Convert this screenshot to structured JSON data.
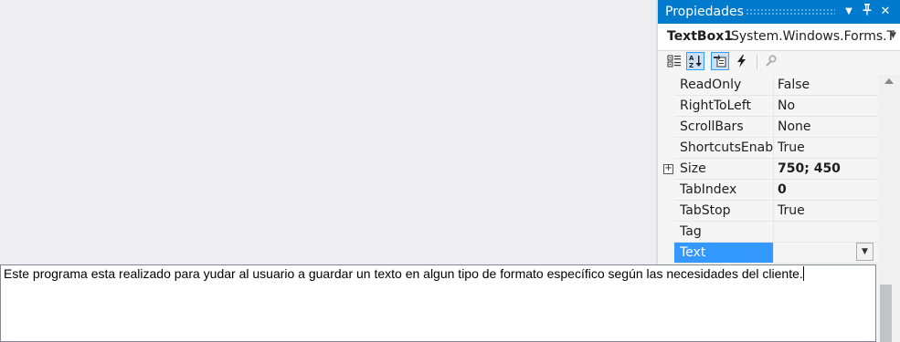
{
  "properties_panel": {
    "title": "Propiedades",
    "title_buttons": [
      "chevron-down-icon",
      "pin-icon",
      "close-icon"
    ],
    "object_selector": {
      "name": "TextBox1",
      "type": "System.Windows.Forms.T"
    },
    "toolbar_icons": [
      "categorized-icon",
      "alphabetical-icon",
      "properties-icon",
      "events-icon",
      "property-pages-icon"
    ],
    "rows": [
      {
        "name": "ReadOnly",
        "value": "False",
        "bold": false
      },
      {
        "name": "RightToLeft",
        "value": "No",
        "bold": false
      },
      {
        "name": "ScrollBars",
        "value": "None",
        "bold": false
      },
      {
        "name": "ShortcutsEnable",
        "value": "True",
        "bold": false
      },
      {
        "name": "Size",
        "value": "750; 450",
        "bold": true,
        "expandable": true
      },
      {
        "name": "TabIndex",
        "value": "0",
        "bold": true
      },
      {
        "name": "TabStop",
        "value": "True",
        "bold": false
      },
      {
        "name": "Tag",
        "value": "",
        "bold": false
      },
      {
        "name": "Text",
        "value": "",
        "bold": false,
        "selected": true
      }
    ],
    "colors": {
      "title_bar": "#007acc",
      "selection": "#3399ff"
    }
  },
  "text_editor": {
    "value": "Este programa esta realizado para yudar al usuario a guardar un texto en algun tipo de formato específico según las necesidades del cliente."
  }
}
